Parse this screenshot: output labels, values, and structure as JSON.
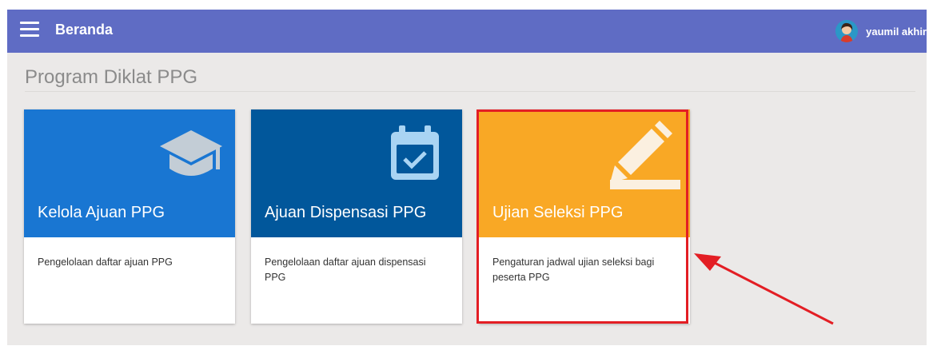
{
  "header": {
    "menu_icon": "hamburger-icon",
    "title": "Beranda",
    "user": {
      "name": "yaumil akhir",
      "avatar_icon": "user-avatar"
    }
  },
  "page": {
    "title": "Program Diklat PPG"
  },
  "cards": [
    {
      "title": "Kelola Ajuan PPG",
      "description": "Pengelolaan daftar ajuan PPG",
      "icon": "graduation-cap-icon",
      "color": "#1976d2"
    },
    {
      "title": "Ajuan Dispensasi PPG",
      "description": "Pengelolaan daftar ajuan dispensasi PPG",
      "icon": "calendar-check-icon",
      "color": "#01579b"
    },
    {
      "title": "Ujian Seleksi PPG",
      "description": "Pengaturan jadwal ujian seleksi bagi peserta PPG",
      "icon": "pencil-icon",
      "color": "#f9a825"
    }
  ],
  "annotation": {
    "color": "#e31e24"
  }
}
